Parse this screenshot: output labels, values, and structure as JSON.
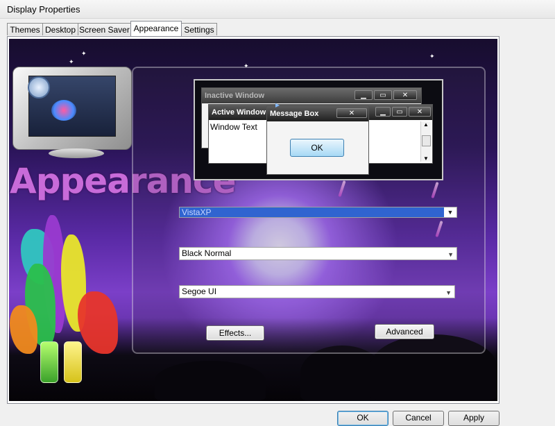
{
  "window": {
    "title": "Display Properties"
  },
  "tabs": [
    {
      "label": "Themes",
      "active": false
    },
    {
      "label": "Desktop",
      "active": false
    },
    {
      "label": "Screen Saver",
      "active": false
    },
    {
      "label": "Appearance",
      "active": true
    },
    {
      "label": "Settings",
      "active": false
    }
  ],
  "artwork": {
    "title": "Appearance"
  },
  "preview": {
    "inactive_window": {
      "title": "Inactive Window"
    },
    "active_window": {
      "title": "Active Window",
      "text": "Window Text"
    },
    "message_box": {
      "title": "Message Box",
      "ok_label": "OK"
    }
  },
  "appearance": {
    "style_value": "VistaXP",
    "color_scheme_value": "Black Normal",
    "font_value": "Segoe UI"
  },
  "buttons": {
    "effects_label": "Effects...",
    "advanced_label": "Advanced"
  },
  "dialog_buttons": {
    "ok_label": "OK",
    "cancel_label": "Cancel",
    "apply_label": "Apply"
  },
  "colors": {
    "selection": "#3064d0",
    "scene_purple": "#7b3fc8",
    "artwork_title": "#c86bd9"
  }
}
